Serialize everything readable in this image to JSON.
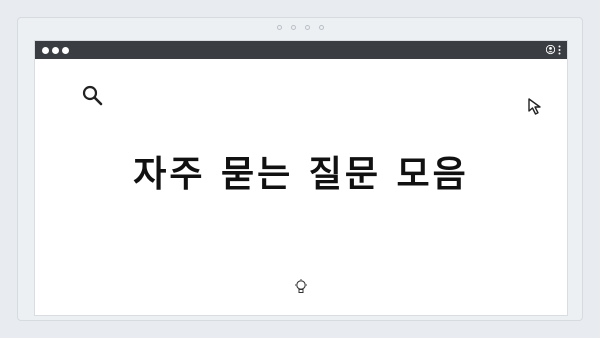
{
  "page": {
    "title": "자주 묻는 질문 모음"
  },
  "icons": {
    "search": "search-icon",
    "cursor": "cursor-icon",
    "lightbulb": "lightbulb-icon",
    "user": "user-icon",
    "menu": "kebab-menu-icon"
  },
  "colors": {
    "titlebar": "#3a3d41",
    "background": "#e8ecf0",
    "text": "#111111"
  }
}
